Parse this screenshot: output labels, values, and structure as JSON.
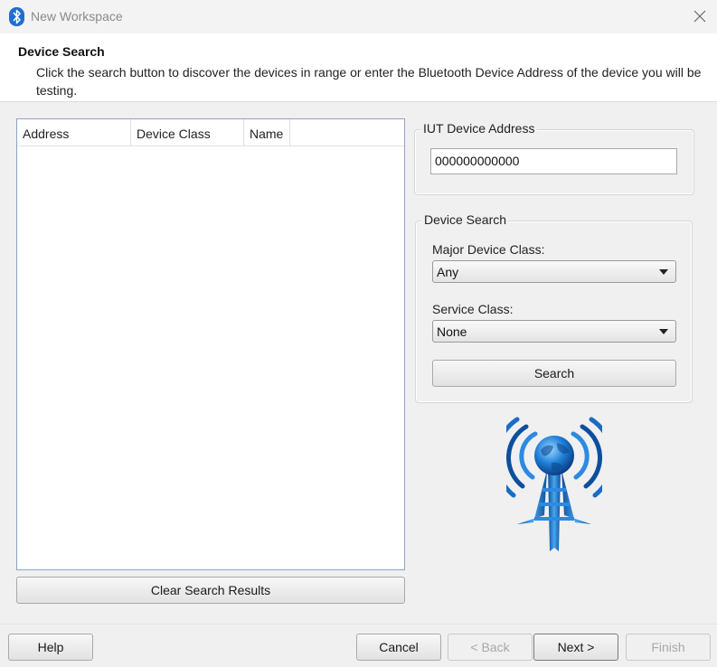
{
  "window": {
    "title": "New Workspace",
    "icon": "bluetooth-icon",
    "close_icon": "close-icon"
  },
  "header": {
    "title": "Device Search",
    "description": "Click the search button to discover the devices in range or enter the Bluetooth Device Address of the device you will be testing."
  },
  "results": {
    "columns": [
      "Address",
      "Device Class",
      "Name"
    ],
    "rows": [],
    "clear_label": "Clear Search Results"
  },
  "iut": {
    "group_label": "IUT Device Address",
    "address": "000000000000"
  },
  "search": {
    "group_label": "Device Search",
    "major_label": "Major Device Class:",
    "major_value": "Any",
    "service_label": "Service Class:",
    "service_value": "None",
    "search_label": "Search"
  },
  "logo": {
    "icon": "bluetooth-tower-globe-icon"
  },
  "footer": {
    "help": "Help",
    "cancel": "Cancel",
    "back": "< Back",
    "next": "Next >",
    "finish": "Finish"
  },
  "colors": {
    "accent_blue": "#1e6fd0",
    "list_border": "#8fa2c4",
    "disabled_text": "#a8a8a8"
  }
}
